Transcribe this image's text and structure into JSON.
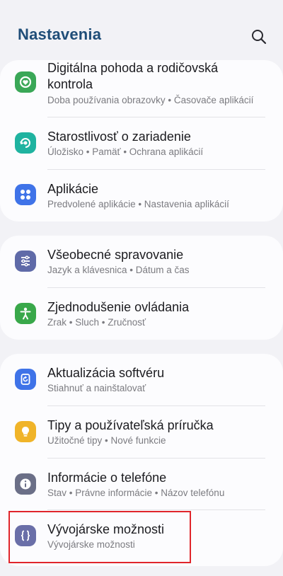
{
  "header": {
    "title": "Nastavenia"
  },
  "icons": {
    "search": "search-icon"
  },
  "groups": [
    {
      "items": [
        {
          "label": "Digitálna pohoda a rodičovská kontrola",
          "sub": "Doba používania obrazovky  •  Časovače aplikácií",
          "icon": "digital-wellbeing-icon",
          "color": "#3aa757"
        },
        {
          "label": "Starostlivosť o zariadenie",
          "sub": "Úložisko  •  Pamäť  •  Ochrana aplikácií",
          "icon": "device-care-icon",
          "color": "#1fb3a0"
        },
        {
          "label": "Aplikácie",
          "sub": "Predvolené aplikácie  •  Nastavenia aplikácií",
          "icon": "apps-icon",
          "color": "#3f73e8"
        }
      ]
    },
    {
      "items": [
        {
          "label": "Všeobecné spravovanie",
          "sub": "Jazyk a klávesnica  •  Dátum a čas",
          "icon": "general-management-icon",
          "color": "#5f6aa8"
        },
        {
          "label": "Zjednodušenie ovládania",
          "sub": "Zrak  •  Sluch  •  Zručnosť",
          "icon": "accessibility-icon",
          "color": "#39a84a"
        }
      ]
    },
    {
      "items": [
        {
          "label": "Aktualizácia softvéru",
          "sub": "Stiahnuť a nainštalovať",
          "icon": "software-update-icon",
          "color": "#3f73e8"
        },
        {
          "label": "Tipy a používateľská príručka",
          "sub": "Užitočné tipy  •  Nové funkcie",
          "icon": "tips-icon",
          "color": "#f0b429"
        },
        {
          "label": "Informácie o telefóne",
          "sub": "Stav  •  Právne informácie  •  Názov telefónu",
          "icon": "about-phone-icon",
          "color": "#6b6f87"
        },
        {
          "label": "Vývojárske možnosti",
          "sub": "Vývojárske možnosti",
          "icon": "developer-options-icon",
          "color": "#6a6fa8"
        }
      ]
    }
  ]
}
